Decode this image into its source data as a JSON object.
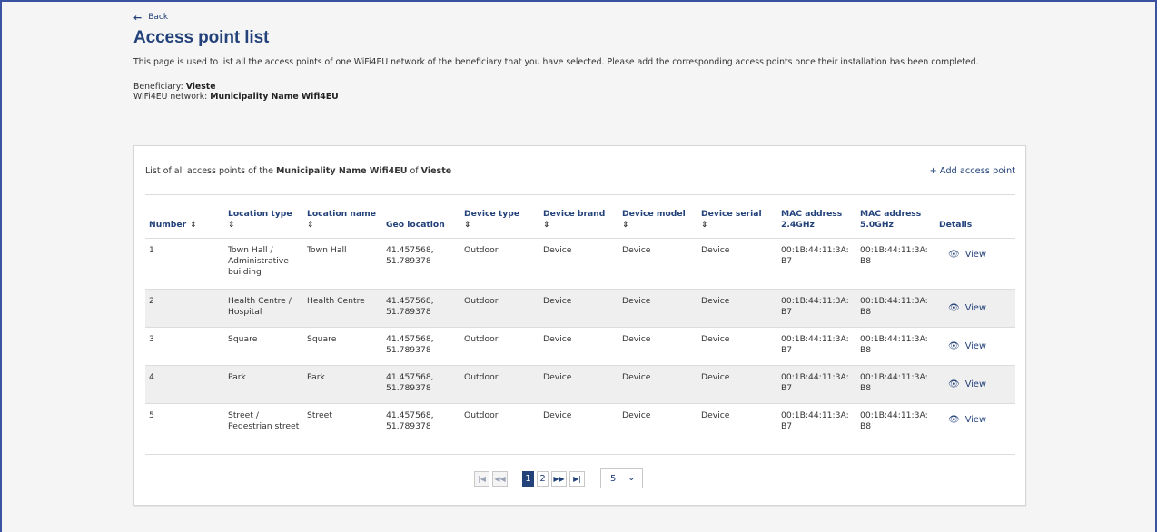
{
  "back_label": "Back",
  "page_title": "Access point list",
  "intro_text": "This page is used to list all the access points of one WiFi4EU network of the beneficiary that you have selected. Please add the corresponding access points once their installation has been completed.",
  "meta": {
    "beneficiary_label": "Beneficiary: ",
    "beneficiary_value": "Vieste",
    "network_label": "WiFi4EU network: ",
    "network_value": "Municipality Name Wifi4EU"
  },
  "card": {
    "heading_prefix": "List of all access points of the ",
    "heading_network": "Municipality Name Wifi4EU",
    "heading_mid": " of ",
    "heading_beneficiary": "Vieste",
    "add_label": "+ Add access point"
  },
  "columns": {
    "number": "Number",
    "location_type": "Location type",
    "location_name": "Location name",
    "geo": "Geo location",
    "device_type": "Device type",
    "device_brand": "Device brand",
    "device_model": "Device model",
    "device_serial": "Device serial",
    "mac24_l1": "MAC address",
    "mac24_l2": "2.4GHz",
    "mac50_l1": "MAC address",
    "mac50_l2": "5.0GHz",
    "details": "Details",
    "sort_glyph": "⇕"
  },
  "rows": [
    {
      "number": "1",
      "location_type": "Town Hall / Administrative building",
      "location_name": "Town Hall",
      "geo": "41.457568, 51.789378",
      "device_type": "Outdoor",
      "device_brand": "Device",
      "device_model": "Device",
      "device_serial": "Device",
      "mac24": "00:1B:44:11:3A: B7",
      "mac50": "00:1B:44:11:3A: B8",
      "view": "View"
    },
    {
      "number": "2",
      "location_type": "Health Centre / Hospital",
      "location_name": "Health Centre",
      "geo": "41.457568, 51.789378",
      "device_type": "Outdoor",
      "device_brand": "Device",
      "device_model": "Device",
      "device_serial": "Device",
      "mac24": "00:1B:44:11:3A: B7",
      "mac50": "00:1B:44:11:3A: B8",
      "view": "View"
    },
    {
      "number": "3",
      "location_type": "Square",
      "location_name": "Square",
      "geo": "41.457568, 51.789378",
      "device_type": "Outdoor",
      "device_brand": "Device",
      "device_model": "Device",
      "device_serial": "Device",
      "mac24": "00:1B:44:11:3A: B7",
      "mac50": "00:1B:44:11:3A: B8",
      "view": "View"
    },
    {
      "number": "4",
      "location_type": "Park",
      "location_name": "Park",
      "geo": "41.457568, 51.789378",
      "device_type": "Outdoor",
      "device_brand": "Device",
      "device_model": "Device",
      "device_serial": "Device",
      "mac24": "00:1B:44:11:3A: B7",
      "mac50": "00:1B:44:11:3A: B8",
      "view": "View"
    },
    {
      "number": "5",
      "location_type": "Street / Pedestrian street",
      "location_name": "Street",
      "geo": "41.457568, 51.789378",
      "device_type": "Outdoor",
      "device_brand": "Device",
      "device_model": "Device",
      "device_serial": "Device",
      "mac24": "00:1B:44:11:3A: B7",
      "mac50": "00:1B:44:11:3A: B8",
      "view": "View"
    }
  ],
  "pagination": {
    "pages": [
      "1",
      "2"
    ],
    "current_page": "1",
    "page_size": "5"
  },
  "colors": {
    "brand": "#23427a",
    "row_alt": "#efefef"
  },
  "icons": {
    "back": "arrow-left-icon",
    "view": "eye-icon",
    "sort": "sort-icon",
    "first": "first-page-icon",
    "prev": "previous-page-icon",
    "next": "next-page-icon",
    "last": "last-page-icon",
    "dropdown": "chevron-down-icon"
  }
}
